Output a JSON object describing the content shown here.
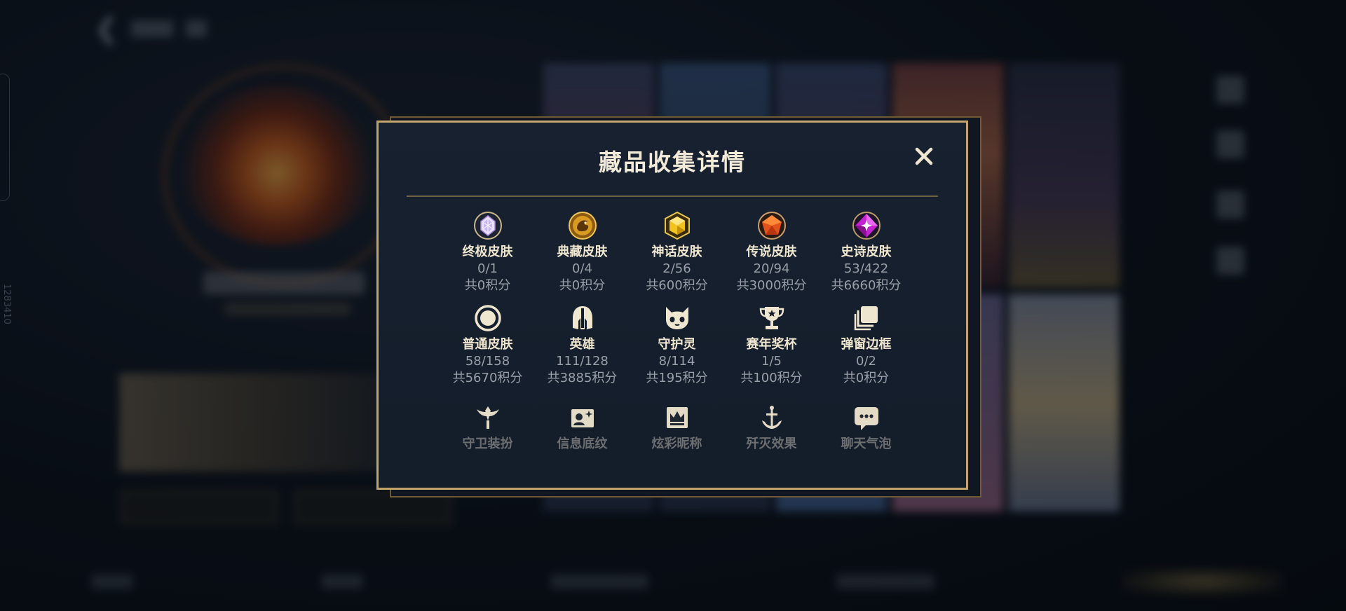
{
  "modal": {
    "title": "藏品收集详情",
    "close_icon": "close-icon"
  },
  "categories": [
    {
      "name": "终极皮肤",
      "count": "0/1",
      "points": "共0积分",
      "icon": "ultimate-gem-icon"
    },
    {
      "name": "典藏皮肤",
      "count": "0/4",
      "points": "共0积分",
      "icon": "dragon-emblem-icon"
    },
    {
      "name": "神话皮肤",
      "count": "2/56",
      "points": "共600积分",
      "icon": "mythic-gem-icon"
    },
    {
      "name": "传说皮肤",
      "count": "20/94",
      "points": "共3000积分",
      "icon": "legendary-gem-icon"
    },
    {
      "name": "史诗皮肤",
      "count": "53/422",
      "points": "共6660积分",
      "icon": "epic-gem-icon"
    },
    {
      "name": "普通皮肤",
      "count": "58/158",
      "points": "共5670积分",
      "icon": "normal-circle-icon"
    },
    {
      "name": "英雄",
      "count": "111/128",
      "points": "共3885积分",
      "icon": "helmet-icon"
    },
    {
      "name": "守护灵",
      "count": "8/114",
      "points": "共195积分",
      "icon": "guardian-pet-icon"
    },
    {
      "name": "赛年奖杯",
      "count": "1/5",
      "points": "共100积分",
      "icon": "trophy-icon"
    },
    {
      "name": "弹窗边框",
      "count": "0/2",
      "points": "共0积分",
      "icon": "stacked-frames-icon"
    }
  ],
  "categories_partial": [
    {
      "name": "守卫装扮",
      "icon": "ward-icon"
    },
    {
      "name": "信息底纹",
      "icon": "profile-card-icon"
    },
    {
      "name": "炫彩昵称",
      "icon": "crown-card-icon"
    },
    {
      "name": "歼灭效果",
      "icon": "anchor-sword-icon"
    },
    {
      "name": "聊天气泡",
      "icon": "chat-bubble-icon"
    }
  ],
  "background": {
    "side_id": "1283410"
  },
  "colors": {
    "modal_border": "#c3a56a",
    "title": "#f1ead9",
    "label": "#efe6cf",
    "muted": "#9aa0a8"
  }
}
